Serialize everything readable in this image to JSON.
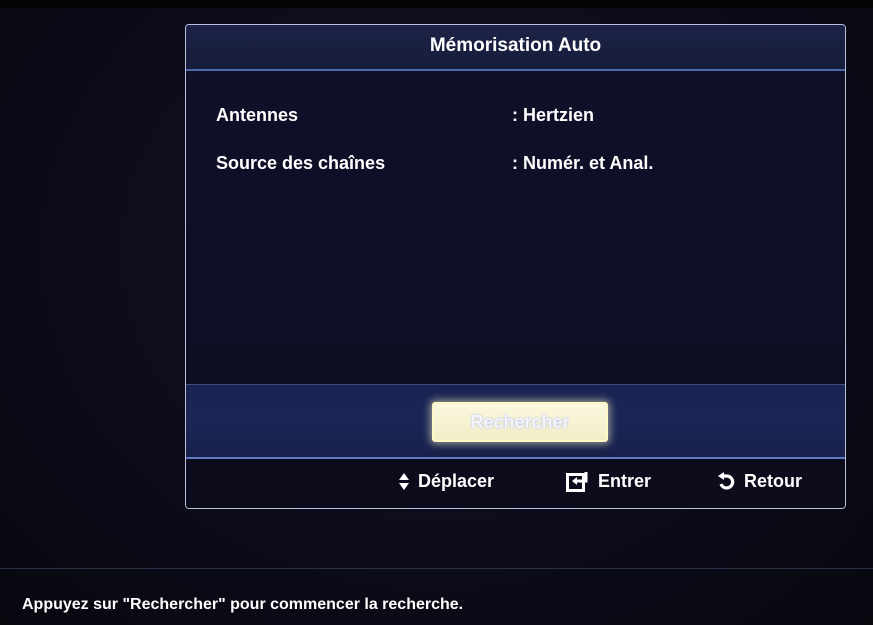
{
  "dialog": {
    "title": "Mémorisation Auto",
    "settings": [
      {
        "label": "Antennes",
        "value": ": Hertzien"
      },
      {
        "label": "Source des chaînes",
        "value": ": Numér. et Anal."
      }
    ],
    "action_button_label": "Rechercher"
  },
  "footer": {
    "move_label": "Déplacer",
    "enter_label": "Entrer",
    "return_label": "Retour",
    "move_icon": "up-down-arrows-icon",
    "enter_icon": "enter-icon",
    "return_icon": "return-arrow-icon"
  },
  "hint": "Appuyez sur \"Rechercher\" pour commencer la recherche.",
  "colors": {
    "accent_border": "#4b6aa8",
    "button_highlight": "#fbf8de",
    "background": "#0b0b1a"
  }
}
